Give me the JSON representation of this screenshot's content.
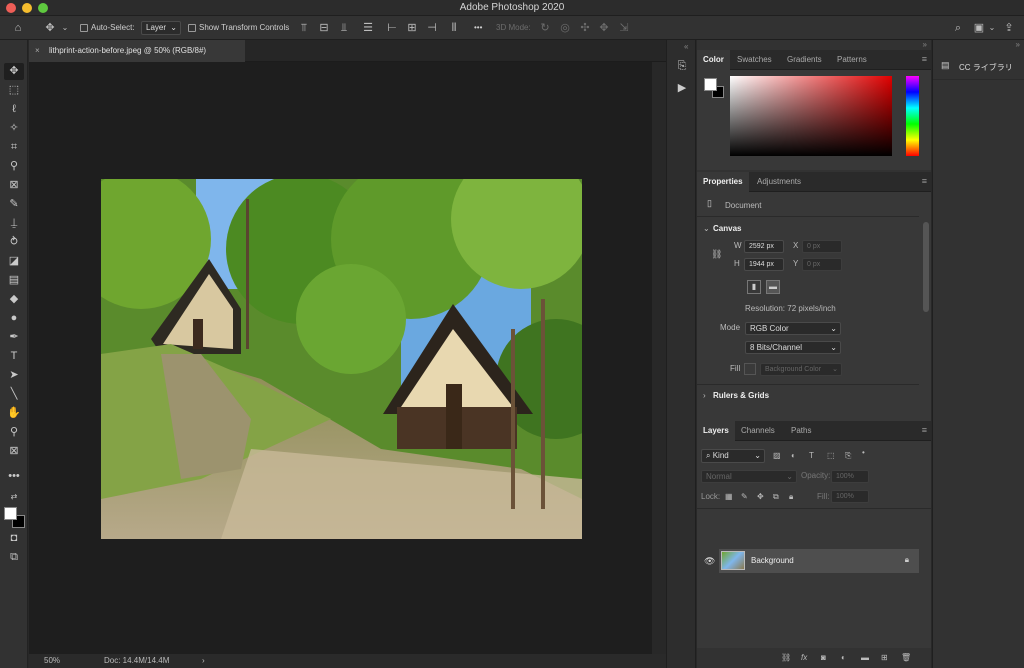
{
  "app": {
    "title": "Adobe Photoshop 2020"
  },
  "options_bar": {
    "auto_select_label": "Auto-Select:",
    "auto_select_value": "Layer",
    "show_transform_label": "Show Transform Controls",
    "mode_3d_label": "3D Mode:",
    "more_label": "•••"
  },
  "document": {
    "tab_title": "lithprint-action-before.jpeg @ 50% (RGB/8#)",
    "zoom": "50%",
    "doc_size": "Doc: 14.4M/14.4M"
  },
  "color_panel": {
    "tabs": [
      "Color",
      "Swatches",
      "Gradients",
      "Patterns"
    ],
    "active_tab": "Color",
    "hue_color": "#e00000"
  },
  "properties_panel": {
    "tabs": [
      "Properties",
      "Adjustments"
    ],
    "document_label": "Document",
    "canvas_header": "Canvas",
    "w_label": "W",
    "w_value": "2592 px",
    "h_label": "H",
    "h_value": "1944 px",
    "x_label": "X",
    "x_placeholder": "0 px",
    "y_label": "Y",
    "y_placeholder": "0 px",
    "resolution": "Resolution: 72 pixels/inch",
    "mode_label": "Mode",
    "mode_value": "RGB Color",
    "bits_value": "8 Bits/Channel",
    "fill_label": "Fill",
    "fill_value": "Background Color",
    "rulers_header": "Rulers & Grids"
  },
  "layers_panel": {
    "tabs": [
      "Layers",
      "Channels",
      "Paths"
    ],
    "kind_label": "Kind",
    "blend_mode": "Normal",
    "opacity_label": "Opacity:",
    "opacity_value": "100%",
    "lock_label": "Lock:",
    "fill_label": "Fill:",
    "fill_value": "100%",
    "layers": [
      {
        "name": "Background",
        "visible": true,
        "locked": true
      }
    ]
  },
  "right_panel": {
    "cc_library": "CC ライブラリ"
  },
  "colors": {
    "accent": "#e00000",
    "bg": "#282828"
  }
}
